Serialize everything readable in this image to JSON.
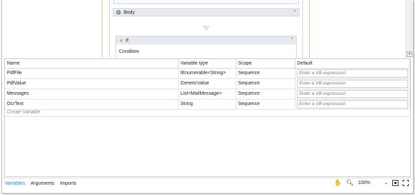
{
  "designer": {
    "body_label": "Body",
    "if_label": "If",
    "condition_label": "Condition"
  },
  "variables_table": {
    "columns": [
      "Name",
      "Variable type",
      "Scope",
      "Default"
    ],
    "rows": [
      {
        "name": "PdfFile",
        "type": "IEnumerable<String>",
        "scope": "Sequence",
        "default_placeholder": "Enter a VB expression"
      },
      {
        "name": "PdfValue",
        "type": "GenericValue",
        "scope": "Sequence",
        "default_placeholder": "Enter a VB expression"
      },
      {
        "name": "Messages",
        "type": "List<MailMessage>",
        "scope": "Sequence",
        "default_placeholder": "Enter a VB expression"
      },
      {
        "name": "OcrText",
        "type": "String",
        "scope": "Sequence",
        "default_placeholder": "Enter a VB expression"
      }
    ],
    "create_variable": "Create Variable"
  },
  "statusbar": {
    "tabs": [
      "Variables",
      "Arguments",
      "Imports"
    ],
    "active_tab": "Variables",
    "zoom": "100%"
  },
  "icons": [
    "sequence-icon",
    "collapse-icon",
    "drop-arrow-icon",
    "if-icon",
    "hand-tool-icon",
    "magnifier-icon",
    "fit-to-screen-icon",
    "full-screen-icon"
  ],
  "colors": {
    "active_tab": "#1b7fcc",
    "frame_orange": "#f1c38c"
  }
}
